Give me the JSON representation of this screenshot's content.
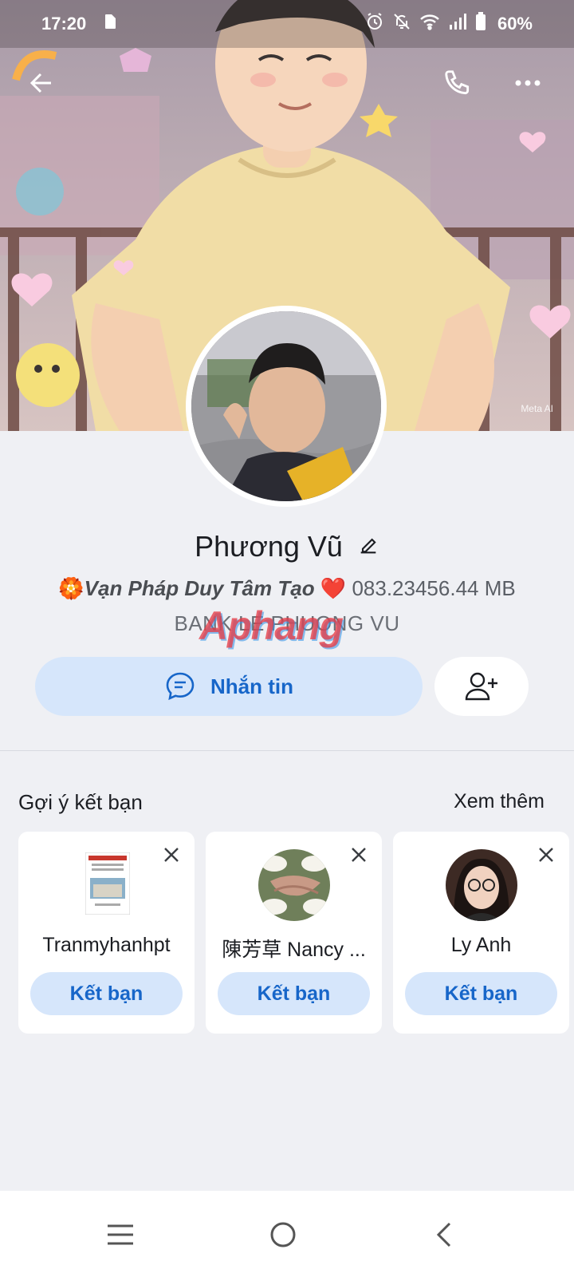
{
  "status_bar": {
    "time": "17:20",
    "battery": "60%",
    "icons": [
      "sim-card-icon",
      "alarm-icon",
      "bell-off-icon",
      "wifi-icon",
      "signal-icon",
      "battery-icon"
    ]
  },
  "header": {
    "back_icon": "arrow-left-icon",
    "call_icon": "phone-icon",
    "more_icon": "more-horizontal-icon",
    "cover_badge": "Meta AI"
  },
  "profile": {
    "name": "Phương Vũ",
    "bio_prefix": "🏵️",
    "bio_italic": "Vạn Pháp Duy Tâm Tạo",
    "bio_heart": "❤️",
    "bio_rest": "083.23456.44 MB",
    "bio_line2": "BANK LE PHUONG VU",
    "watermark": "Aphang"
  },
  "actions": {
    "message_label": "Nhắn tin"
  },
  "suggestions": {
    "title": "Gợi ý kết bạn",
    "see_more": "Xem thêm",
    "cards": [
      {
        "name": "Tranmyhanhpt",
        "button": "Kết bạn"
      },
      {
        "name": "陳芳草 Nancy ...",
        "button": "Kết bạn"
      },
      {
        "name": "Ly Anh",
        "button": "Kết bạn"
      }
    ]
  },
  "colors": {
    "accent": "#1766c9",
    "accent_bg": "#d6e6fb",
    "page_bg": "#eff0f4"
  }
}
